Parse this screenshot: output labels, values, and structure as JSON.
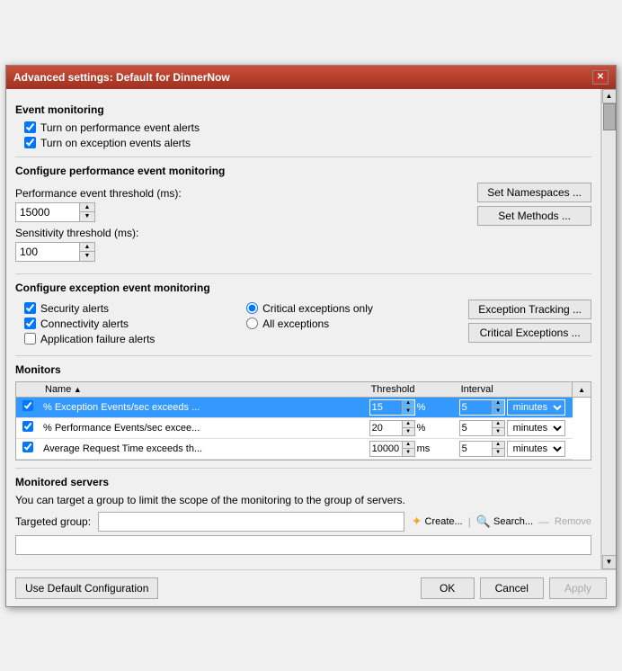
{
  "window": {
    "title": "Advanced settings: Default for DinnerNow",
    "close_btn": "✕"
  },
  "event_monitoring": {
    "title": "Event monitoring",
    "perf_alerts_label": "Turn on performance event alerts",
    "exception_alerts_label": "Turn on exception events alerts",
    "perf_alerts_checked": true,
    "exception_alerts_checked": true
  },
  "configure_perf": {
    "title": "Configure performance event monitoring",
    "perf_threshold_label": "Performance event threshold (ms):",
    "perf_threshold_value": "15000",
    "sensitivity_label": "Sensitivity threshold (ms):",
    "sensitivity_value": "100",
    "set_namespaces_label": "Set Namespaces ...",
    "set_methods_label": "Set Methods ..."
  },
  "configure_exception": {
    "title": "Configure exception event monitoring",
    "security_alerts_label": "Security alerts",
    "connectivity_alerts_label": "Connectivity alerts",
    "app_failure_label": "Application failure alerts",
    "critical_only_label": "Critical exceptions only",
    "all_exceptions_label": "All exceptions",
    "exception_tracking_label": "Exception Tracking ...",
    "critical_exceptions_label": "Critical Exceptions ..."
  },
  "monitors": {
    "title": "Monitors",
    "columns": {
      "name": "Name",
      "threshold": "Threshold",
      "interval": "Interval"
    },
    "rows": [
      {
        "checked": true,
        "name": "% Exception Events/sec exceeds ...",
        "threshold_value": "15",
        "threshold_unit": "%",
        "interval_value": "5",
        "interval_unit": "minutes",
        "selected": true
      },
      {
        "checked": true,
        "name": "% Performance Events/sec excee...",
        "threshold_value": "20",
        "threshold_unit": "%",
        "interval_value": "5",
        "interval_unit": "minutes",
        "selected": false
      },
      {
        "checked": true,
        "name": "Average Request Time exceeds th...",
        "threshold_value": "10000",
        "threshold_unit": "ms",
        "interval_value": "5",
        "interval_unit": "minutes",
        "selected": false
      }
    ]
  },
  "monitored_servers": {
    "title": "Monitored servers",
    "description": "You can target a group to limit the scope of the monitoring to the group of servers.",
    "targeted_group_label": "Targeted group:",
    "create_label": "Create...",
    "search_label": "Search...",
    "remove_label": "Remove"
  },
  "bottom": {
    "use_default_label": "Use Default Configuration",
    "ok_label": "OK",
    "cancel_label": "Cancel",
    "apply_label": "Apply"
  }
}
